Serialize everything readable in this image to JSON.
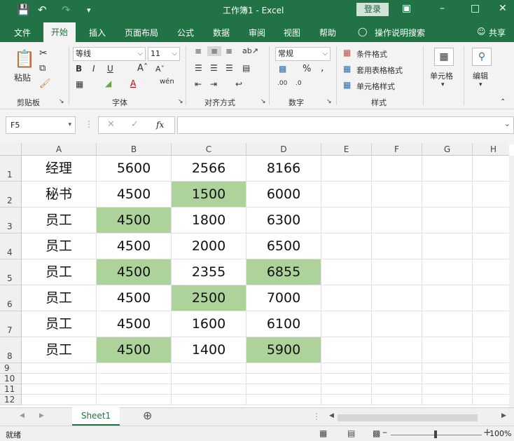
{
  "titlebar": {
    "title": "工作簿1  -  Excel",
    "login": "登录"
  },
  "tabs": [
    "文件",
    "开始",
    "插入",
    "页面布局",
    "公式",
    "数据",
    "审阅",
    "视图",
    "帮助"
  ],
  "tell_me": "操作说明搜索",
  "share": "共享",
  "ribbon": {
    "clipboard": {
      "label": "剪贴板",
      "paste": "粘贴"
    },
    "font": {
      "label": "字体",
      "name": "等线",
      "size": "11"
    },
    "align": {
      "label": "对齐方式"
    },
    "number": {
      "label": "数字",
      "format": "常规"
    },
    "styles": {
      "label": "样式",
      "cond": "条件格式",
      "table": "套用表格格式",
      "cell": "单元格样式"
    },
    "cells": {
      "label": "单元格"
    },
    "edit": {
      "label": "编辑"
    }
  },
  "formula_bar": {
    "name_box": "F5",
    "fx": "fx"
  },
  "columns": [
    "A",
    "B",
    "C",
    "D",
    "E",
    "F",
    "G",
    "H"
  ],
  "rows": [
    {
      "num": "1",
      "cells": [
        "经理",
        "5600",
        "2566",
        "8166"
      ],
      "green": [
        false,
        false,
        false,
        false
      ]
    },
    {
      "num": "2",
      "cells": [
        "秘书",
        "4500",
        "1500",
        "6000"
      ],
      "green": [
        false,
        false,
        true,
        false
      ]
    },
    {
      "num": "3",
      "cells": [
        "员工",
        "4500",
        "1800",
        "6300"
      ],
      "green": [
        false,
        true,
        false,
        false
      ]
    },
    {
      "num": "4",
      "cells": [
        "员工",
        "4500",
        "2000",
        "6500"
      ],
      "green": [
        false,
        false,
        false,
        false
      ]
    },
    {
      "num": "5",
      "cells": [
        "员工",
        "4500",
        "2355",
        "6855"
      ],
      "green": [
        false,
        true,
        false,
        true
      ]
    },
    {
      "num": "6",
      "cells": [
        "员工",
        "4500",
        "2500",
        "7000"
      ],
      "green": [
        false,
        false,
        true,
        false
      ]
    },
    {
      "num": "7",
      "cells": [
        "员工",
        "4500",
        "1600",
        "6100"
      ],
      "green": [
        false,
        false,
        false,
        false
      ]
    },
    {
      "num": "8",
      "cells": [
        "员工",
        "4500",
        "1400",
        "5900"
      ],
      "green": [
        false,
        true,
        false,
        true
      ]
    }
  ],
  "empty_rows": [
    "9",
    "10",
    "11",
    "12"
  ],
  "highlight_color": "#aed39a",
  "sheet_tab": "Sheet1",
  "status": {
    "ready": "就绪",
    "zoom": "100%"
  }
}
